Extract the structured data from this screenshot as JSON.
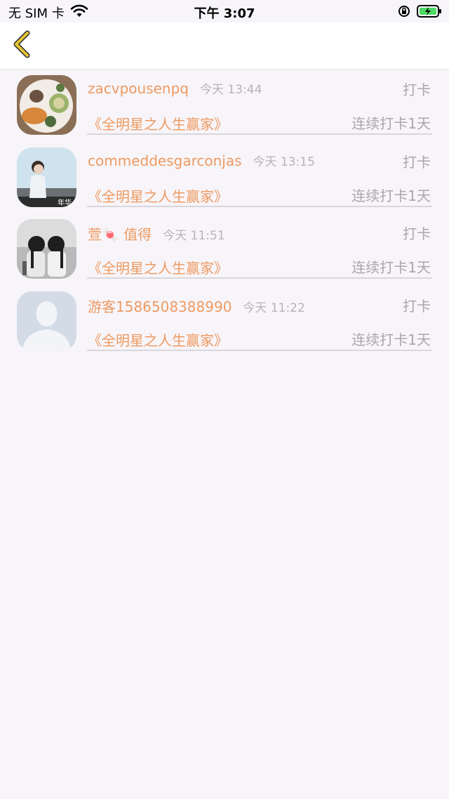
{
  "status_bar": {
    "carrier": "无 SIM 卡",
    "time": "下午 3:07",
    "icons": [
      "wifi-icon",
      "rotation-lock-icon",
      "battery-charging-icon"
    ]
  },
  "nav": {
    "back_icon": "chevron-left-icon",
    "accent_color": "#e5c735"
  },
  "rows": [
    {
      "name": "zacvpousenpq",
      "time": "今天 13:44",
      "action": "打卡",
      "book": "《全明星之人生赢家》",
      "streak": "连续打卡1天"
    },
    {
      "name": "commeddesgarconjas",
      "time": "今天 13:15",
      "action": "打卡",
      "book": "《全明星之人生赢家》",
      "streak": "连续打卡1天"
    },
    {
      "name": "萱🍬 值得",
      "time": "今天 11:51",
      "action": "打卡",
      "book": "《全明星之人生赢家》",
      "streak": "连续打卡1天"
    },
    {
      "name": "游客1586508388990",
      "time": "今天 11:22",
      "action": "打卡",
      "book": "《全明星之人生赢家》",
      "streak": "连续打卡1天"
    }
  ],
  "colors": {
    "name": "#ee9a62",
    "muted": "#aaa6ab",
    "background": "#f7f5f9"
  }
}
